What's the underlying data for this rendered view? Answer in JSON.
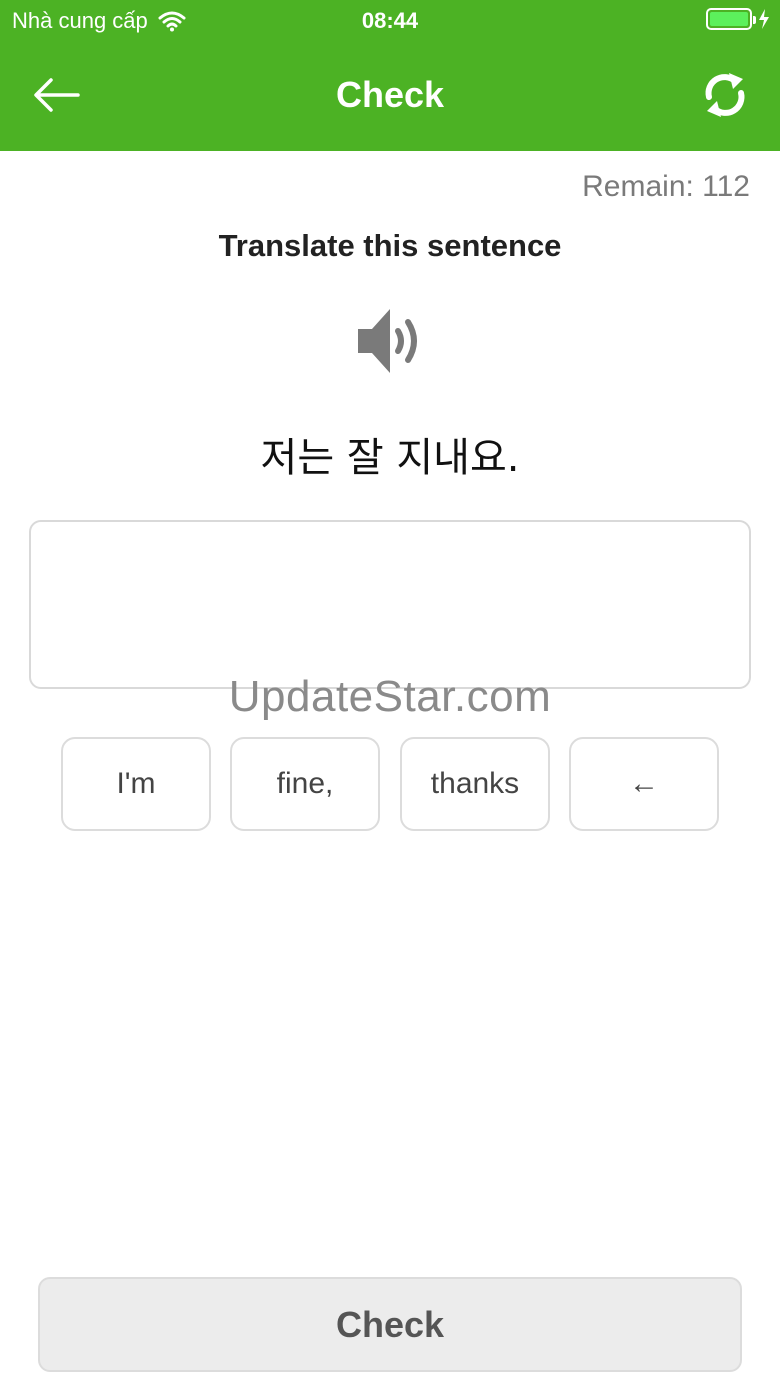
{
  "status_bar": {
    "carrier": "Nhà cung cấp",
    "time": "08:44",
    "wifi_icon": "wifi-icon",
    "battery_icon": "battery-icon"
  },
  "nav": {
    "title": "Check",
    "back_icon": "back-arrow-icon",
    "refresh_icon": "refresh-icon"
  },
  "exercise": {
    "remain": "Remain: 112",
    "instruction": "Translate this sentence",
    "speaker_icon": "speaker-icon",
    "sentence": "저는 잘 지내요.",
    "answer_value": ""
  },
  "watermark": "UpdateStar.com",
  "word_bank": [
    "I'm",
    "fine,",
    "thanks",
    "←"
  ],
  "footer": {
    "check_label": "Check"
  },
  "colors": {
    "accent": "#4cb224",
    "battery": "#5cf05c"
  }
}
